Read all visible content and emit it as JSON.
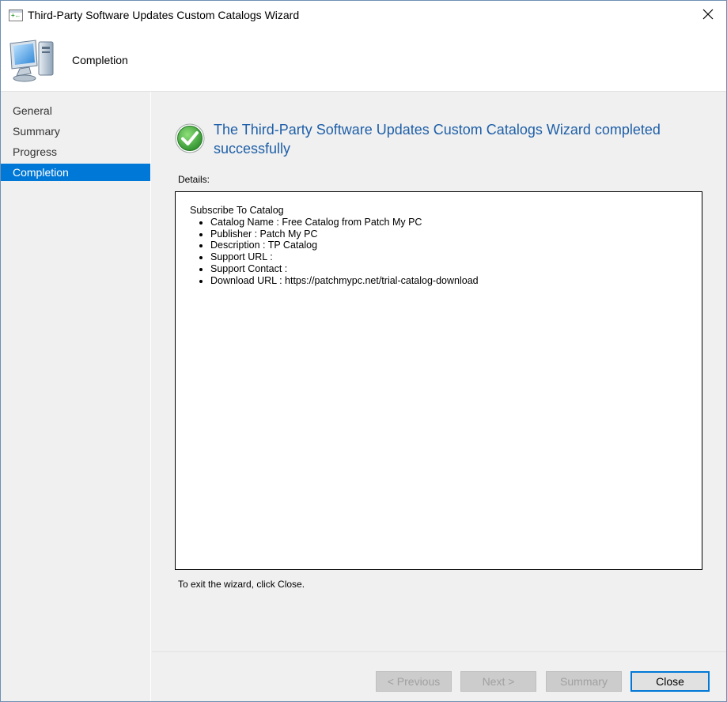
{
  "window": {
    "title": "Third-Party Software Updates Custom Catalogs Wizard"
  },
  "header": {
    "title": "Completion"
  },
  "nav": {
    "items": [
      {
        "label": "General",
        "active": false
      },
      {
        "label": "Summary",
        "active": false
      },
      {
        "label": "Progress",
        "active": false
      },
      {
        "label": "Completion",
        "active": true
      }
    ]
  },
  "main": {
    "success_message": "The Third-Party Software Updates Custom Catalogs Wizard completed successfully",
    "details_label": "Details:",
    "details_heading": "Subscribe To Catalog",
    "details_items": [
      "Catalog Name : Free Catalog from Patch My PC",
      "Publisher : Patch My PC",
      "Description : TP Catalog",
      "Support URL :",
      "Support Contact :",
      "Download URL : https://patchmypc.net/trial-catalog-download"
    ],
    "exit_hint": "To exit the wizard, click Close."
  },
  "footer": {
    "previous_label": "< Previous",
    "next_label": "Next >",
    "summary_label": "Summary",
    "close_label": "Close"
  },
  "colors": {
    "accent": "#0078d7",
    "success_title": "#1e5fa8",
    "success_icon": "#3aa43a"
  },
  "icons": {
    "title": "wizard-app-icon",
    "header": "computer-monitor-icon",
    "success": "green-checkmark-icon",
    "close": "close-icon"
  }
}
